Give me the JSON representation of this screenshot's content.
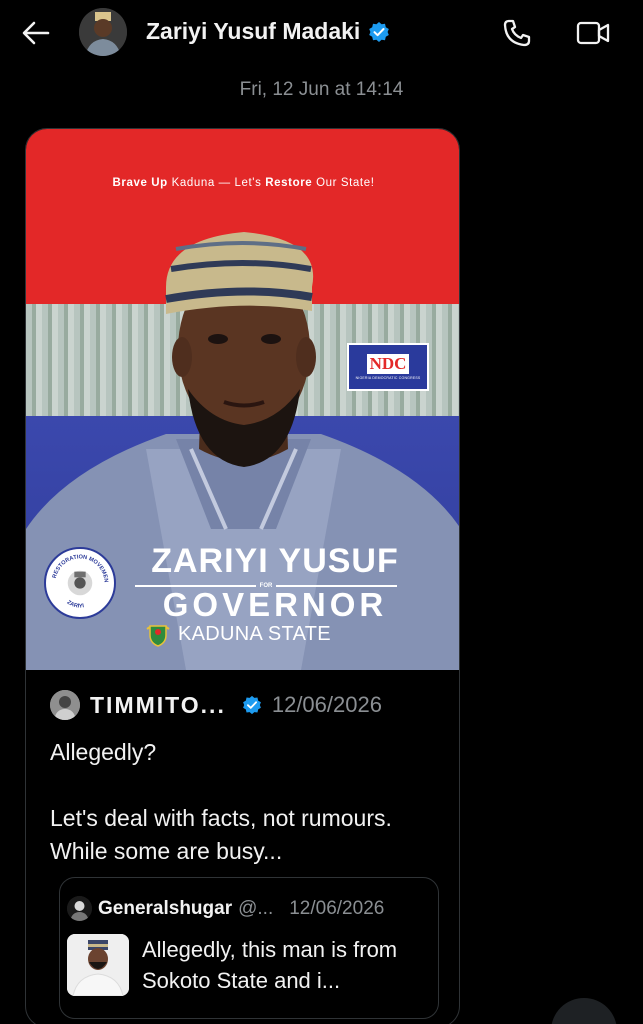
{
  "header": {
    "title": "Zariyi Yusuf Madaki",
    "back_icon": "arrow-left-icon",
    "call_icon": "phone-icon",
    "video_icon": "video-camera-icon"
  },
  "timestamp": "Fri, 12 Jun at 14:14",
  "poster": {
    "tagline_1": "Brave Up",
    "tagline_2": " Kaduna — Let's ",
    "tagline_3": "Restore",
    "tagline_4": " Our State!",
    "party": "NDC",
    "party_sub": "NIGERIA DEMOCRATIC CONGRESS",
    "seal_top": "RESTORATION MOVEMENT",
    "seal_bottom": "ZARIYI",
    "name": "ZARIYI YUSUF",
    "for": "FOR",
    "office": "GOVERNOR",
    "state": "KADUNA STATE",
    "colors": {
      "red": "#e32828",
      "blue": "#3441a1"
    }
  },
  "quote": {
    "author": "TIMMITO...",
    "date": "12/06/2026",
    "text_1": "Allegedly?",
    "text_2": "Let's deal with facts, not rumours. While some are busy...",
    "inner": {
      "author": "Generalshugar",
      "handle": "@...",
      "date": "12/06/2026",
      "text": "Allegedly, this man is from Sokoto State and i..."
    }
  },
  "accent": "#1d9bf0"
}
